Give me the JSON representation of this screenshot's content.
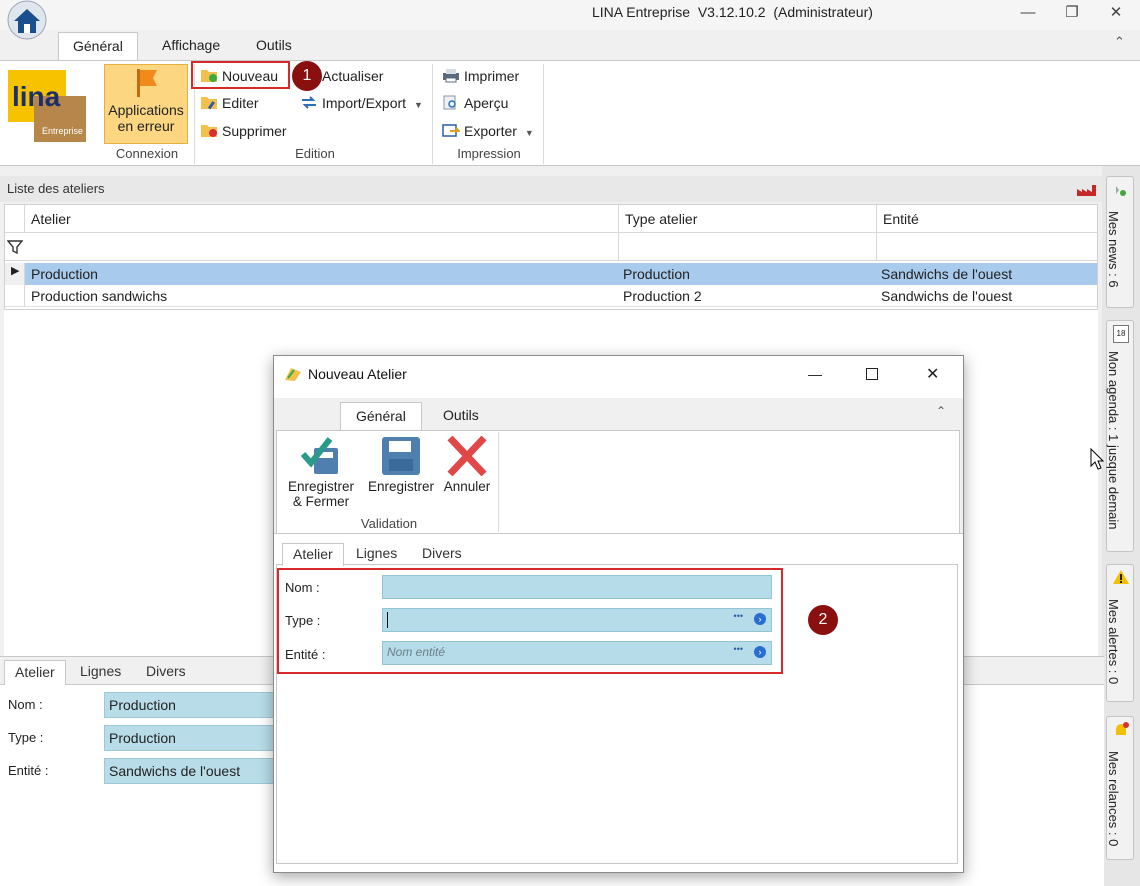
{
  "window": {
    "title": "LINA Entreprise  V3.12.10.2  (Administrateur)",
    "minimize": "—",
    "restore": "❐",
    "close": "✕",
    "collapse": "⌃"
  },
  "ribbon": {
    "tabs": [
      "Général",
      "Affichage",
      "Outils"
    ],
    "logo_text": "lina",
    "logo_sub": "Entreprise",
    "connexion": {
      "button": "Applications en erreur",
      "label": "Connexion"
    },
    "edition": {
      "nouveau": "Nouveau",
      "editer": "Editer",
      "supprimer": "Supprimer",
      "actualiser": "Actualiser",
      "import_export": "Import/Export",
      "label": "Edition"
    },
    "impression": {
      "imprimer": "Imprimer",
      "apercu": "Aperçu",
      "exporter": "Exporter",
      "label": "Impression"
    }
  },
  "list": {
    "title": "Liste des ateliers",
    "columns": [
      "Atelier",
      "Type atelier",
      "Entité"
    ],
    "rows": [
      [
        "Production",
        "Production",
        "Sandwichs de l'ouest"
      ],
      [
        "Production sandwichs",
        "Production 2",
        "Sandwichs de l'ouest"
      ]
    ]
  },
  "side_panel": {
    "news": "Mes news : 6",
    "agenda_badge": "18",
    "agenda": "Mon agenda : 1 jusque demain",
    "alertes": "Mes alertes : 0",
    "relances": "Mes relances : 0"
  },
  "detail": {
    "tabs": [
      "Atelier",
      "Lignes",
      "Divers"
    ],
    "fields": [
      {
        "label": "Nom :",
        "value": "Production"
      },
      {
        "label": "Type :",
        "value": "Production"
      },
      {
        "label": "Entité :",
        "value": "Sandwichs de l'ouest"
      }
    ]
  },
  "modal": {
    "title": "Nouveau Atelier",
    "ribbon_tabs": [
      "Général",
      "Outils"
    ],
    "buttons": {
      "save_close": "Enregistrer & Fermer",
      "save": "Enregistrer",
      "cancel": "Annuler"
    },
    "group_label": "Validation",
    "tabs": [
      "Atelier",
      "Lignes",
      "Divers"
    ],
    "fields": {
      "nom_label": "Nom :",
      "type_label": "Type :",
      "entite_label": "Entité :",
      "entite_placeholder": "Nom entité",
      "dots": "•••"
    }
  },
  "badges": {
    "one": "1",
    "two": "2"
  },
  "colors": {
    "selected_row": "#a8cbed",
    "field": "#b6dce9",
    "highlight": "#d62a2a",
    "badge": "#8a1010"
  }
}
